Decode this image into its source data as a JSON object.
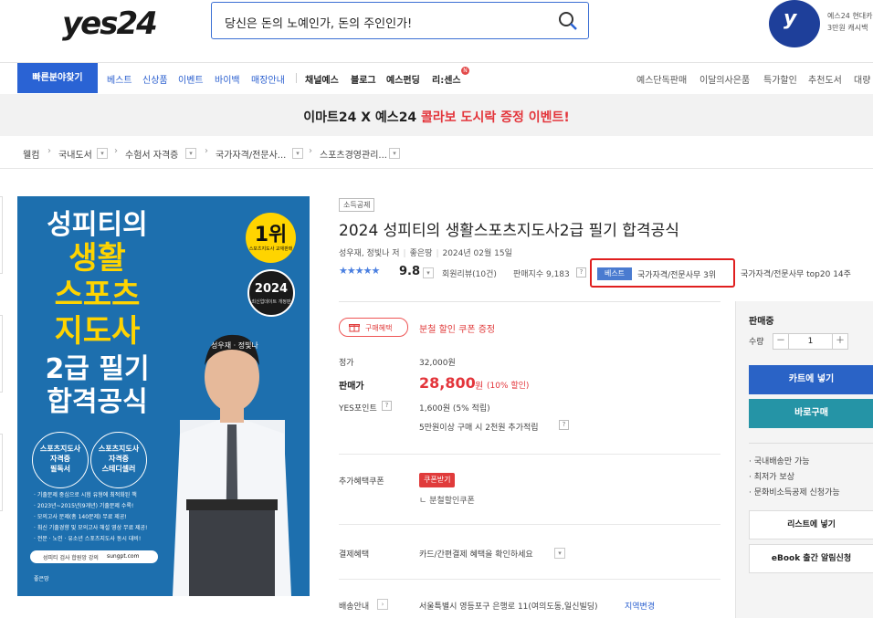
{
  "header": {
    "logo": "yes24",
    "search_value": "당신은 돈의 노예인가, 돈의 주인인가!",
    "promo_badge_letter": "y",
    "promo_line1": "예스24 현대카",
    "promo_line2": "3만원 캐시백"
  },
  "nav": {
    "quick_find": "빠른분야찾기",
    "blue_items": [
      "베스트",
      "신상품",
      "이벤트",
      "바이백",
      "매장안내"
    ],
    "dark_items": [
      "채널예스",
      "블로그",
      "예스펀딩",
      "리:센스"
    ],
    "new_badge": "N",
    "right_items": [
      "예스단독판매",
      "이달의사은품",
      "특가할인",
      "추천도서",
      "대량"
    ]
  },
  "banner": {
    "text_prefix": "이마트24 X 예스24 ",
    "text_highlight": "콜라보 도시락 증정 이벤트!"
  },
  "breadcrumb": [
    "웰컴",
    "국내도서",
    "수험서 자격증",
    "국가자격/전문사...",
    "스포츠경영관리..."
  ],
  "cover": {
    "title_line1": "성피티의",
    "title_line2": "생활",
    "title_line3": "스포츠",
    "title_line4": "지도사",
    "title_line5": "2급 필기",
    "title_line6": "합격공식",
    "badge_num": "1위",
    "badge_sub": "스포츠지도사 교재판매",
    "badge2_year": "2024",
    "badge2_sub": "최신업데이트 개정판",
    "authors": "성우재 · 정빛나",
    "circle1": "스포츠지도사\n자격증\n필독서",
    "circle2": "스포츠지도사\n자격증\n스테디셀러",
    "bullets": [
      "· 기출문제 중심으로 시험 유형에 최적화된 책",
      "· 2023년~2015년(9개년) 기출문제 수록!",
      "· 모의고사 문제(총 140문제) 무료 제공!",
      "· 최신 기출경향 및 모의고사 해설 영상 무료 제공!",
      "· 전문 · 노인 · 유소년 스포츠지도사 동시 대비!"
    ],
    "site_label": "성피티 검사 합원앙 강의",
    "site_url": "sungpt.com",
    "publisher": "좋은땅"
  },
  "product": {
    "category_tag": "소득공제",
    "title": "2024 성피티의 생활스포츠지도사2급 필기 합격공식",
    "author": "성우재, 정빛나 저",
    "publisher": "좋은땅",
    "date": "2024년 02월 15일",
    "stars": "★★★★★",
    "rating": "9.8",
    "review": "회원리뷰(10건)",
    "sales": "판매지수 9,183",
    "qmark": "?",
    "best_tag": "베스트",
    "best_rank": "국가자격/전문사무 3위",
    "top20": "국가자격/전문사무 top20 14주",
    "gift_label": "구매혜택",
    "coupon_event": "분철 할인 쿠폰 증정",
    "price_label": "정가",
    "price": "32,000원",
    "sale_label": "판매가",
    "sale_price": "28,800",
    "sale_unit": "원",
    "discount": "(10% 할인)",
    "points_label": "YES포인트",
    "points": "1,600원 (5% 적립)",
    "extra_points": "5만원이상 구매 시 2천원 추가적립",
    "benefit_coupon_label": "추가혜택쿠폰",
    "coupon_tag": "쿠폰받기",
    "coupon_sub": "ㄴ 분철할인쿠폰",
    "payment_label": "결제혜택",
    "payment_value": "카드/간편결제 혜택을 확인하세요",
    "shipping_label": "배송안내",
    "shipping_value": "서울특별시 영등포구 은행로 11(여의도동,일신빌딩)",
    "region_change": "지역변경"
  },
  "panel": {
    "status": "판매중",
    "qty_label": "수량",
    "qty_minus": "－",
    "qty_value": "1",
    "qty_plus": "＋",
    "cart": "카트에 넣기",
    "buy": "바로구매",
    "features": [
      "· 국내배송만 가능",
      "· 최저가 보상",
      "· 문화비소득공제 신청가능"
    ],
    "list": "리스트에 넣기",
    "alert": "eBook 출간 알림신청"
  },
  "colors": {
    "brand_blue": "#2a63d4",
    "accent_red": "#e3353b",
    "cover_blue": "#1d6fae",
    "cover_yellow": "#ffd400"
  }
}
